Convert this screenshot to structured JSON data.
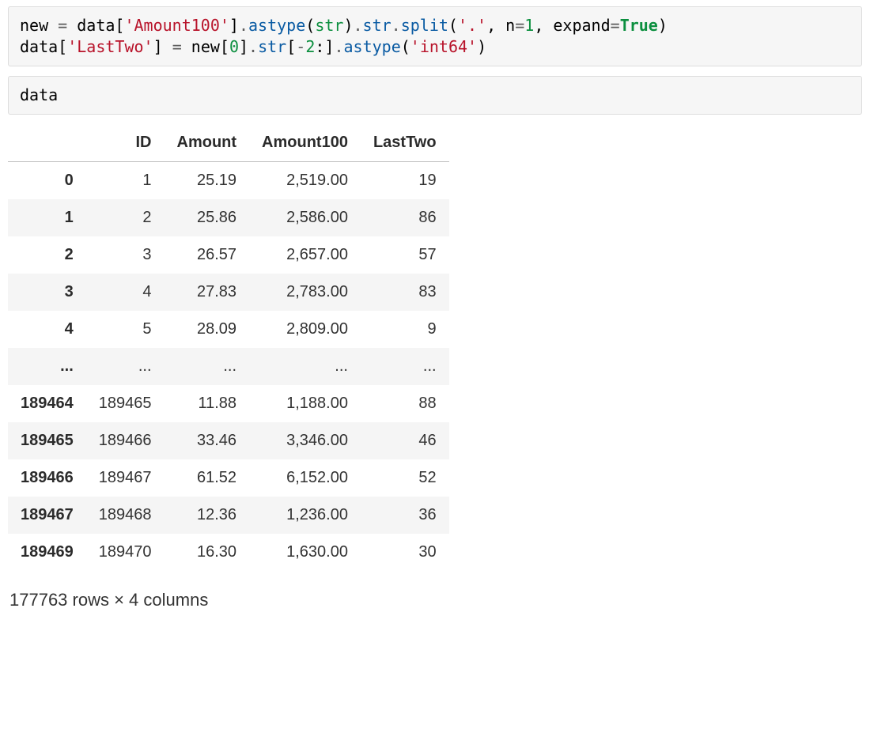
{
  "code_cell_1": {
    "tokens": [
      {
        "t": "new ",
        "c": "tok-default"
      },
      {
        "t": "=",
        "c": "tok-op"
      },
      {
        "t": " data[",
        "c": "tok-default"
      },
      {
        "t": "'Amount100'",
        "c": "tok-str"
      },
      {
        "t": "]",
        "c": "tok-default"
      },
      {
        "t": ".",
        "c": "tok-op"
      },
      {
        "t": "astype",
        "c": "tok-method"
      },
      {
        "t": "(",
        "c": "tok-default"
      },
      {
        "t": "str",
        "c": "tok-builtin"
      },
      {
        "t": ")",
        "c": "tok-default"
      },
      {
        "t": ".",
        "c": "tok-op"
      },
      {
        "t": "str",
        "c": "tok-method"
      },
      {
        "t": ".",
        "c": "tok-op"
      },
      {
        "t": "split",
        "c": "tok-method"
      },
      {
        "t": "(",
        "c": "tok-default"
      },
      {
        "t": "'.'",
        "c": "tok-str"
      },
      {
        "t": ", n",
        "c": "tok-default"
      },
      {
        "t": "=",
        "c": "tok-op"
      },
      {
        "t": "1",
        "c": "tok-num"
      },
      {
        "t": ", expand",
        "c": "tok-default"
      },
      {
        "t": "=",
        "c": "tok-op"
      },
      {
        "t": "True",
        "c": "tok-kw"
      },
      {
        "t": ")",
        "c": "tok-default"
      },
      {
        "t": "\n",
        "c": "tok-default"
      },
      {
        "t": "data[",
        "c": "tok-default"
      },
      {
        "t": "'LastTwo'",
        "c": "tok-str"
      },
      {
        "t": "] ",
        "c": "tok-default"
      },
      {
        "t": "=",
        "c": "tok-op"
      },
      {
        "t": " new[",
        "c": "tok-default"
      },
      {
        "t": "0",
        "c": "tok-num"
      },
      {
        "t": "]",
        "c": "tok-default"
      },
      {
        "t": ".",
        "c": "tok-op"
      },
      {
        "t": "str",
        "c": "tok-method"
      },
      {
        "t": "[",
        "c": "tok-default"
      },
      {
        "t": "-",
        "c": "tok-op"
      },
      {
        "t": "2",
        "c": "tok-num"
      },
      {
        "t": ":]",
        "c": "tok-default"
      },
      {
        "t": ".",
        "c": "tok-op"
      },
      {
        "t": "astype",
        "c": "tok-method"
      },
      {
        "t": "(",
        "c": "tok-default"
      },
      {
        "t": "'int64'",
        "c": "tok-str"
      },
      {
        "t": ")",
        "c": "tok-default"
      }
    ]
  },
  "code_cell_2": {
    "tokens": [
      {
        "t": "data",
        "c": "tok-default"
      }
    ]
  },
  "dataframe": {
    "columns": [
      "ID",
      "Amount",
      "Amount100",
      "LastTwo"
    ],
    "rows": [
      {
        "index": "0",
        "cells": [
          "1",
          "25.19",
          "2,519.00",
          "19"
        ],
        "stripe": false
      },
      {
        "index": "1",
        "cells": [
          "2",
          "25.86",
          "2,586.00",
          "86"
        ],
        "stripe": true
      },
      {
        "index": "2",
        "cells": [
          "3",
          "26.57",
          "2,657.00",
          "57"
        ],
        "stripe": false
      },
      {
        "index": "3",
        "cells": [
          "4",
          "27.83",
          "2,783.00",
          "83"
        ],
        "stripe": true
      },
      {
        "index": "4",
        "cells": [
          "5",
          "28.09",
          "2,809.00",
          "9"
        ],
        "stripe": false
      },
      {
        "index": "...",
        "cells": [
          "...",
          "...",
          "...",
          "..."
        ],
        "stripe": true
      },
      {
        "index": "189464",
        "cells": [
          "189465",
          "11.88",
          "1,188.00",
          "88"
        ],
        "stripe": false
      },
      {
        "index": "189465",
        "cells": [
          "189466",
          "33.46",
          "3,346.00",
          "46"
        ],
        "stripe": true
      },
      {
        "index": "189466",
        "cells": [
          "189467",
          "61.52",
          "6,152.00",
          "52"
        ],
        "stripe": false
      },
      {
        "index": "189467",
        "cells": [
          "189468",
          "12.36",
          "1,236.00",
          "36"
        ],
        "stripe": true
      },
      {
        "index": "189469",
        "cells": [
          "189470",
          "16.30",
          "1,630.00",
          "30"
        ],
        "stripe": false
      }
    ],
    "summary": "177763 rows × 4 columns"
  }
}
